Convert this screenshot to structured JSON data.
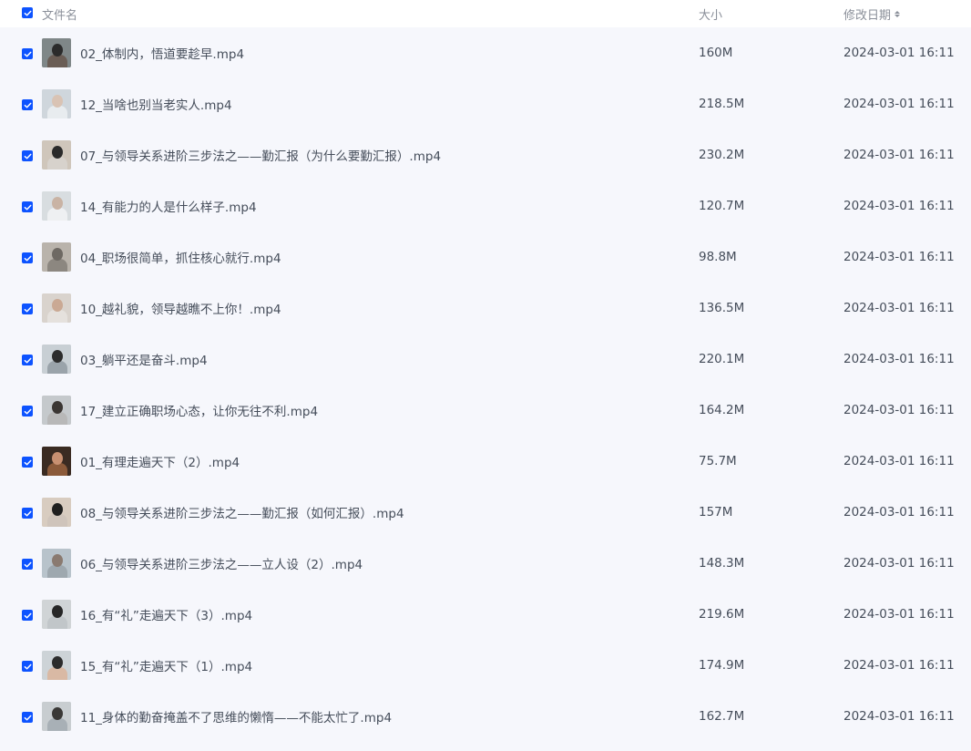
{
  "header": {
    "col_name": "文件名",
    "col_size": "大小",
    "col_date": "修改日期"
  },
  "files": [
    {
      "name": "02_体制内，悟道要趁早.mp4",
      "size": "160M",
      "date": "2024-03-01 16:11"
    },
    {
      "name": "12_当啥也别当老实人.mp4",
      "size": "218.5M",
      "date": "2024-03-01 16:11"
    },
    {
      "name": "07_与领导关系进阶三步法之——勤汇报（为什么要勤汇报）.mp4",
      "size": "230.2M",
      "date": "2024-03-01 16:11"
    },
    {
      "name": "14_有能力的人是什么样子.mp4",
      "size": "120.7M",
      "date": "2024-03-01 16:11"
    },
    {
      "name": "04_职场很简单，抓住核心就行.mp4",
      "size": "98.8M",
      "date": "2024-03-01 16:11"
    },
    {
      "name": "10_越礼貌，领导越瞧不上你！.mp4",
      "size": "136.5M",
      "date": "2024-03-01 16:11"
    },
    {
      "name": "03_躺平还是奋斗.mp4",
      "size": "220.1M",
      "date": "2024-03-01 16:11"
    },
    {
      "name": "17_建立正确职场心态，让你无往不利.mp4",
      "size": "164.2M",
      "date": "2024-03-01 16:11"
    },
    {
      "name": "01_有理走遍天下（2）.mp4",
      "size": "75.7M",
      "date": "2024-03-01 16:11"
    },
    {
      "name": "08_与领导关系进阶三步法之——勤汇报（如何汇报）.mp4",
      "size": "157M",
      "date": "2024-03-01 16:11"
    },
    {
      "name": "06_与领导关系进阶三步法之——立人设（2）.mp4",
      "size": "148.3M",
      "date": "2024-03-01 16:11"
    },
    {
      "name": "16_有“礼”走遍天下（3）.mp4",
      "size": "219.6M",
      "date": "2024-03-01 16:11"
    },
    {
      "name": "15_有“礼”走遍天下（1）.mp4",
      "size": "174.9M",
      "date": "2024-03-01 16:11"
    },
    {
      "name": "11_身体的勤奋掩盖不了思维的懒惰——不能太忙了.mp4",
      "size": "162.7M",
      "date": "2024-03-01 16:11"
    }
  ],
  "colors": {
    "accent": "#0d53ff",
    "list_background": "#f6f7fc",
    "header_text": "#8a8f99",
    "row_text": "#454d5a"
  }
}
